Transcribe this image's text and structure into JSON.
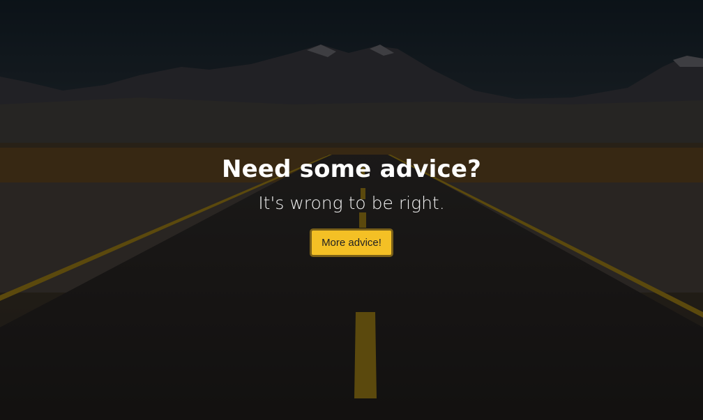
{
  "hero": {
    "headline": "Need some advice?",
    "advice": "It's wrong to be right.",
    "button_label": "More advice!"
  },
  "background": {
    "scene": "road-through-desert-with-mountains",
    "overlay_opacity": 0.55
  },
  "colors": {
    "button_bg": "#f4c025",
    "button_border": "#7a6018",
    "road_line": "#c9a21d",
    "text": "#ffffff"
  }
}
